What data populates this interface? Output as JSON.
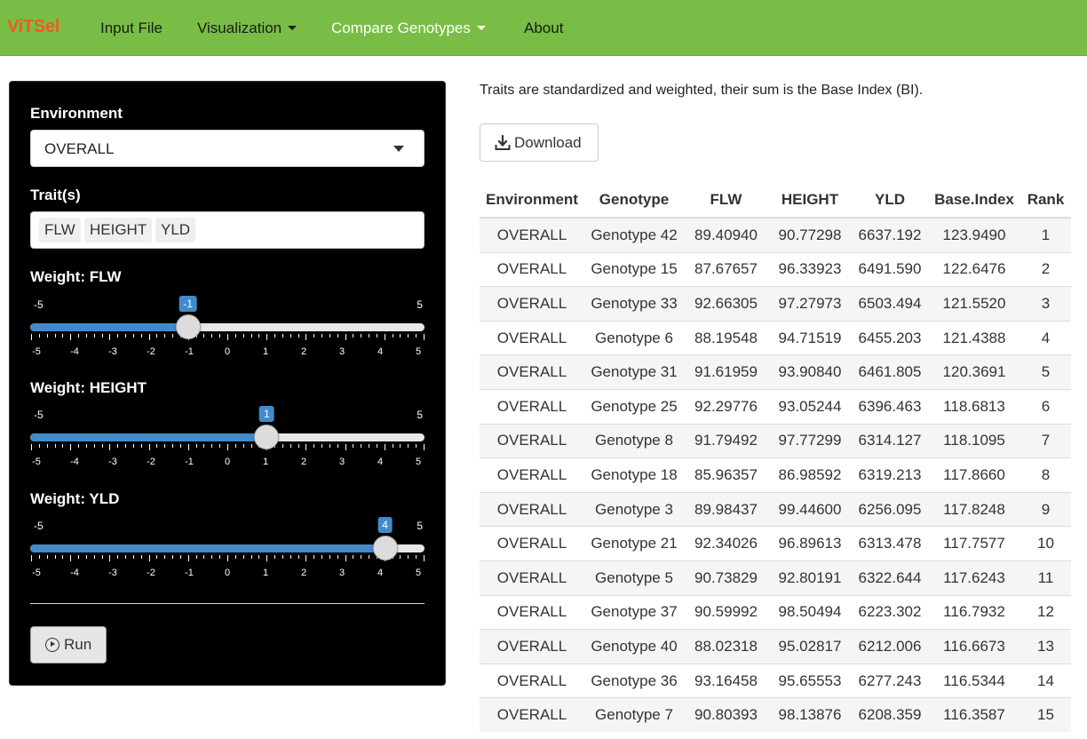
{
  "navbar": {
    "brand": "ViTSel",
    "items": [
      {
        "label": "Input File"
      },
      {
        "label": "Visualization"
      },
      {
        "label": "Compare Genotypes"
      },
      {
        "label": "About"
      }
    ],
    "active_item": "Compare Genotypes",
    "color": "#79bd46",
    "brand_color": "#f15a22"
  },
  "sidebar": {
    "environment": {
      "label": "Environment",
      "value": "OVERALL"
    },
    "traits": {
      "label": "Trait(s)",
      "selected": [
        "FLW",
        "HEIGHT",
        "YLD"
      ]
    },
    "weights": [
      {
        "label": "Weight: FLW",
        "min": -5,
        "max": 5,
        "value": -1
      },
      {
        "label": "Weight: HEIGHT",
        "min": -5,
        "max": 5,
        "value": 1
      },
      {
        "label": "Weight: YLD",
        "min": -5,
        "max": 5,
        "value": 4
      }
    ],
    "tick_labels": [
      "-5",
      "-4",
      "-3",
      "-2",
      "-1",
      "0",
      "1",
      "2",
      "3",
      "4",
      "5"
    ],
    "run_button": {
      "label": "Run",
      "icon": "play-circle-icon"
    },
    "accent": "#428bca"
  },
  "main": {
    "description": "Traits are standardized and weighted, their sum is the Base Index (BI).",
    "download_button": {
      "label": "Download",
      "icon": "download-icon"
    },
    "table": {
      "columns": [
        "Environment",
        "Genotype",
        "FLW",
        "HEIGHT",
        "YLD",
        "Base.Index",
        "Rank"
      ],
      "rows": [
        [
          "OVERALL",
          "Genotype 42",
          "89.40940",
          "90.77298",
          "6637.192",
          "123.9490",
          "1"
        ],
        [
          "OVERALL",
          "Genotype 15",
          "87.67657",
          "96.33923",
          "6491.590",
          "122.6476",
          "2"
        ],
        [
          "OVERALL",
          "Genotype 33",
          "92.66305",
          "97.27973",
          "6503.494",
          "121.5520",
          "3"
        ],
        [
          "OVERALL",
          "Genotype 6",
          "88.19548",
          "94.71519",
          "6455.203",
          "121.4388",
          "4"
        ],
        [
          "OVERALL",
          "Genotype 31",
          "91.61959",
          "93.90840",
          "6461.805",
          "120.3691",
          "5"
        ],
        [
          "OVERALL",
          "Genotype 25",
          "92.29776",
          "93.05244",
          "6396.463",
          "118.6813",
          "6"
        ],
        [
          "OVERALL",
          "Genotype 8",
          "91.79492",
          "97.77299",
          "6314.127",
          "118.1095",
          "7"
        ],
        [
          "OVERALL",
          "Genotype 18",
          "85.96357",
          "86.98592",
          "6319.213",
          "117.8660",
          "8"
        ],
        [
          "OVERALL",
          "Genotype 3",
          "89.98437",
          "99.44600",
          "6256.095",
          "117.8248",
          "9"
        ],
        [
          "OVERALL",
          "Genotype 21",
          "92.34026",
          "96.89613",
          "6313.478",
          "117.7577",
          "10"
        ],
        [
          "OVERALL",
          "Genotype 5",
          "90.73829",
          "92.80191",
          "6322.644",
          "117.6243",
          "11"
        ],
        [
          "OVERALL",
          "Genotype 37",
          "90.59992",
          "98.50494",
          "6223.302",
          "116.7932",
          "12"
        ],
        [
          "OVERALL",
          "Genotype 40",
          "88.02318",
          "95.02817",
          "6212.006",
          "116.6673",
          "13"
        ],
        [
          "OVERALL",
          "Genotype 36",
          "93.16458",
          "95.65553",
          "6277.243",
          "116.5344",
          "14"
        ],
        [
          "OVERALL",
          "Genotype 7",
          "90.80393",
          "98.13876",
          "6208.359",
          "116.3587",
          "15"
        ]
      ]
    }
  }
}
